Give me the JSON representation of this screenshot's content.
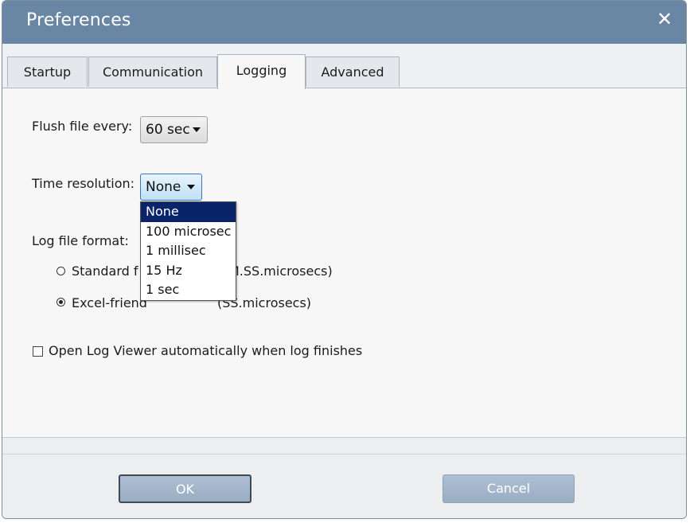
{
  "window": {
    "title": "Preferences",
    "close_glyph": "✕"
  },
  "tabs": [
    {
      "label": "Startup",
      "active": false
    },
    {
      "label": "Communication",
      "active": false
    },
    {
      "label": "Logging",
      "active": true
    },
    {
      "label": "Advanced",
      "active": false
    }
  ],
  "logging": {
    "flush": {
      "label": "Flush file every:",
      "value": "60 sec"
    },
    "time_resolution": {
      "label": "Time resolution:",
      "value": "None",
      "options": [
        "None",
        "100 microsec",
        "1 millisec",
        "15 Hz",
        "1 sec"
      ],
      "selected_index": 0,
      "open": true
    },
    "log_format": {
      "label": "Log file format:",
      "standard_visible_left": "Standard f",
      "standard_visible_right": "M.SS.microsecs)",
      "excel_visible_left": "Excel-friend",
      "excel_visible_right": "(SS.microsecs)",
      "selected": "excel"
    },
    "auto_open": {
      "label": "Open Log Viewer automatically when log finishes",
      "checked": false
    }
  },
  "buttons": {
    "ok_label": "OK",
    "cancel_label": "Cancel"
  },
  "colors": {
    "titlebar": "#6a86a5",
    "selection": "#0a246a",
    "button": "#a4b6ca"
  }
}
